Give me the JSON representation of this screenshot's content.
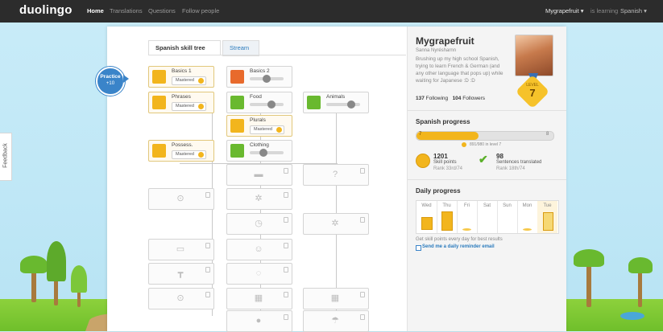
{
  "topbar": {
    "logo": "duolingo",
    "nav": [
      "Home",
      "Translations",
      "Questions",
      "Follow people"
    ],
    "user_menu": "Mygrapefruit ▾",
    "learning_label": "is learning",
    "language_menu": "Spanish ▾"
  },
  "feedback_label": "Feedback",
  "tabs": {
    "skill_tree": "Spanish skill tree",
    "stream": "Stream"
  },
  "practice": {
    "label": "Practice",
    "bonus": "+10"
  },
  "skills": [
    {
      "name": "Basics 1",
      "status": "Mastered",
      "icon_color": "#f2b51d"
    },
    {
      "name": "Basics 2",
      "status": "in-progress",
      "icon_color": "#e86a2c"
    },
    {
      "name": "Phrases",
      "status": "Mastered",
      "icon_color": "#f2b51d"
    },
    {
      "name": "Food",
      "status": "in-progress",
      "icon_color": "#69b92f"
    },
    {
      "name": "Animals",
      "status": "in-progress",
      "icon_color": "#69b92f"
    },
    {
      "name": "Plurals",
      "status": "Mastered",
      "icon_color": "#f2b51d"
    },
    {
      "name": "Possess.",
      "status": "Mastered",
      "icon_color": "#f2b51d"
    },
    {
      "name": "Clothing",
      "status": "in-progress",
      "icon_color": "#69b92f"
    }
  ],
  "locked_icons": [
    "dumbbell-icon",
    "question-icon",
    "bicycle-icon",
    "gear-icon",
    "clock-icon",
    "gear-icon",
    "briefcase-icon",
    "people-icon",
    "faucet-icon",
    "chat-icon",
    "bicycle-icon",
    "calendar-icon",
    "calendar-icon",
    "globe-icon",
    "umbrella-icon"
  ],
  "profile": {
    "username": "Mygrapefruit",
    "real_name": "Sanna  Nyrésharnn",
    "bio": "Brushing up my high school Spanish, trying to learn French & German (and any other language that pops up) while waiting for Japanese :D :D",
    "level_label": "LEVEL",
    "level": "7",
    "following": "137",
    "following_label": "Following",
    "followers": "104",
    "followers_label": "Followers"
  },
  "spanish_progress": {
    "title": "Spanish progress",
    "level_from": "7",
    "level_to": "8",
    "progress": 0.45,
    "points_text": "891/980 in level 7",
    "skill_points": "1201",
    "skill_points_label": "Skill points",
    "skill_rank": "Rank 33rd/74",
    "sentences": "98",
    "sentences_label": "Sentences translated",
    "sentences_rank": "Rank 18th/74"
  },
  "daily_progress": {
    "title": "Daily progress",
    "days": [
      "Wed",
      "Thu",
      "Fri",
      "Sat",
      "Sun",
      "Mon",
      "Tue"
    ],
    "hint": "Get skill points every day for best results",
    "reminder": "Send me a daily reminder email"
  },
  "colors": {
    "accent": "#3a84c9",
    "gold": "#f2b51d",
    "green": "#69b92f"
  }
}
